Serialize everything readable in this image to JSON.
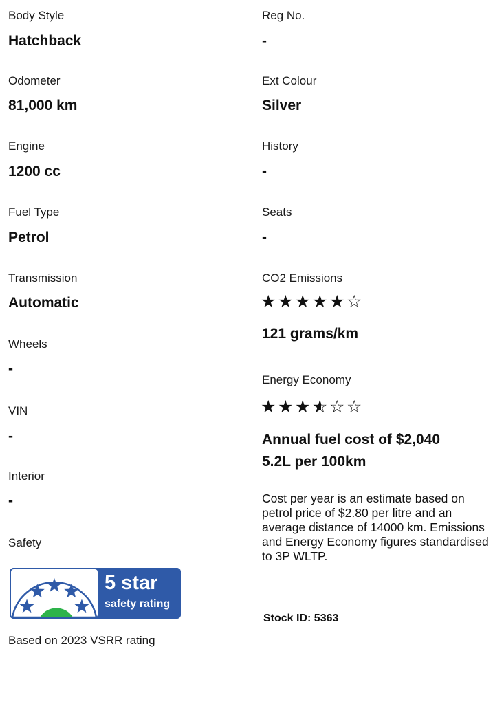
{
  "left": {
    "body_style": {
      "label": "Body Style",
      "value": "Hatchback"
    },
    "odometer": {
      "label": "Odometer",
      "value": "81,000 km"
    },
    "engine": {
      "label": "Engine",
      "value": "1200 cc"
    },
    "fuel_type": {
      "label": "Fuel Type",
      "value": "Petrol"
    },
    "transmission": {
      "label": "Transmission",
      "value": "Automatic"
    },
    "wheels": {
      "label": "Wheels",
      "value": "-"
    },
    "vin": {
      "label": "VIN",
      "value": "-"
    },
    "interior": {
      "label": "Interior",
      "value": "-"
    },
    "safety": {
      "label": "Safety",
      "badge_big": "5 star",
      "badge_small": "safety rating",
      "badge_stars": 5,
      "based_on": "Based on 2023 VSRR rating"
    }
  },
  "right": {
    "reg_no": {
      "label": "Reg No.",
      "value": "-"
    },
    "ext_colour": {
      "label": "Ext Colour",
      "value": "Silver"
    },
    "history": {
      "label": "History",
      "value": "-"
    },
    "seats": {
      "label": "Seats",
      "value": "-"
    },
    "co2": {
      "label": "CO2 Emissions",
      "rating": 5,
      "max": 6,
      "value": "121 grams/km"
    },
    "energy": {
      "label": "Energy Economy",
      "rating": 3.5,
      "max": 6,
      "fuel_cost": "Annual fuel cost of $2,040",
      "consumption": "5.2L per 100km",
      "note": "Cost per year is an estimate based on petrol price of  $2.80 per litre and an average distance of 14000 km. Emissions and Energy Economy figures standardised to 3P WLTP."
    },
    "stock_id": "Stock ID: 5363"
  },
  "colors": {
    "badge_blue": "#2f5aa8",
    "badge_star": "#2f5aa8",
    "badge_green": "#2db34a",
    "text": "#111111"
  }
}
